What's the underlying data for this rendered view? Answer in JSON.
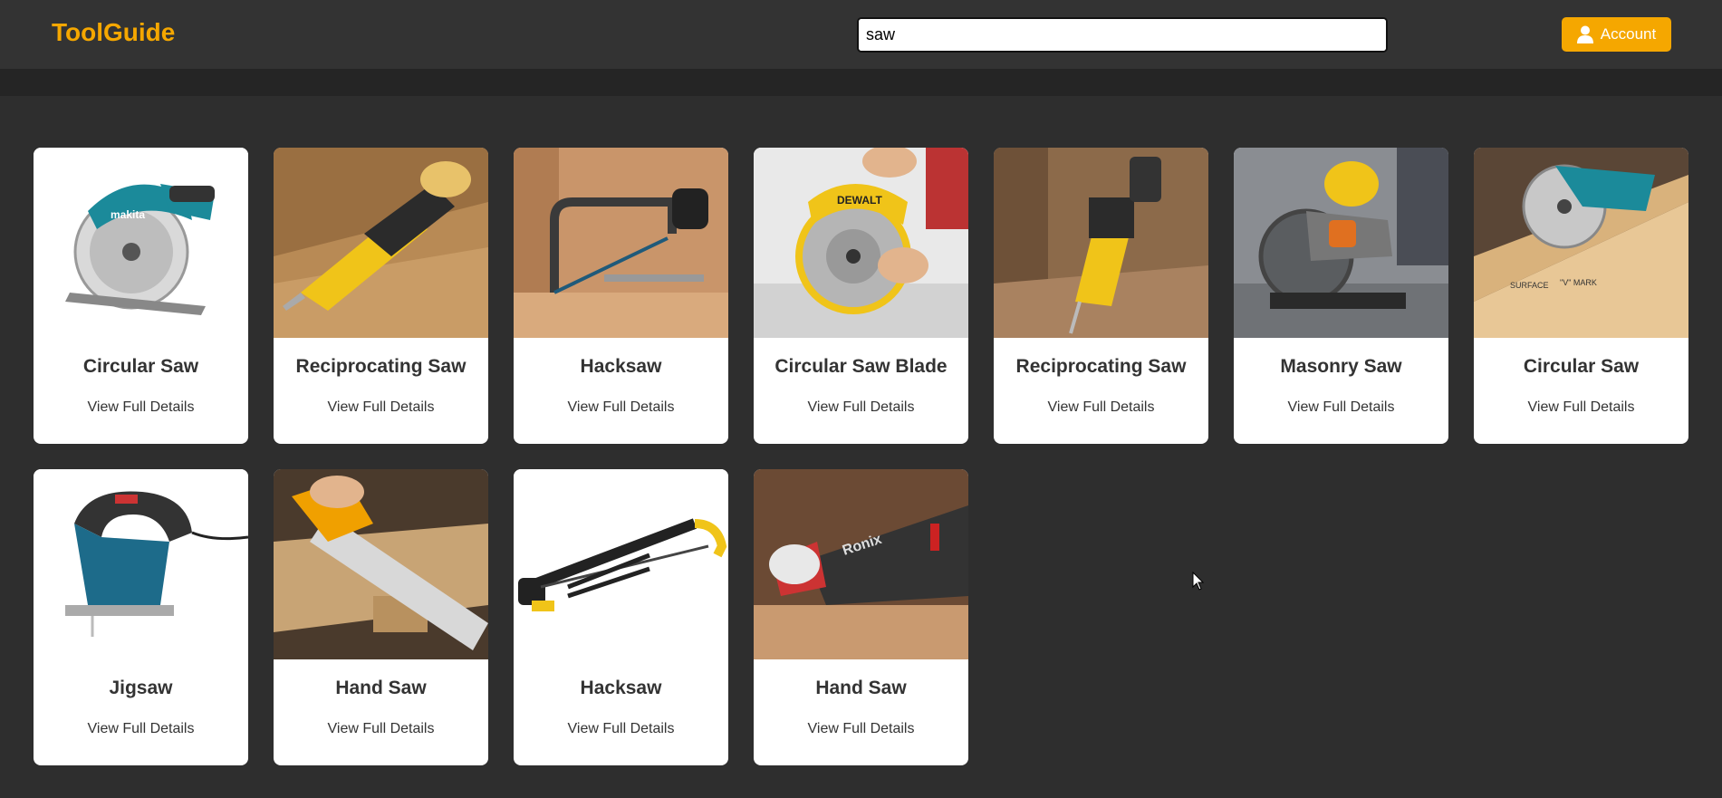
{
  "header": {
    "brand": "ToolGuide",
    "search_value": "saw",
    "account_label": "Account"
  },
  "colors": {
    "brand": "#f5a700",
    "background": "#2e2e2e",
    "topbar": "#333333"
  },
  "cards": [
    {
      "title": "Circular Saw",
      "link": "View Full Details",
      "icon": "circular-saw-icon"
    },
    {
      "title": "Reciprocating Saw",
      "link": "View Full Details",
      "icon": "reciprocating-saw-icon"
    },
    {
      "title": "Hacksaw",
      "link": "View Full Details",
      "icon": "hacksaw-icon"
    },
    {
      "title": "Circular Saw Blade",
      "link": "View Full Details",
      "icon": "circular-saw-blade-icon"
    },
    {
      "title": "Reciprocating Saw",
      "link": "View Full Details",
      "icon": "reciprocating-saw-icon"
    },
    {
      "title": "Masonry Saw",
      "link": "View Full Details",
      "icon": "masonry-saw-icon"
    },
    {
      "title": "Circular Saw",
      "link": "View Full Details",
      "icon": "circular-saw-icon"
    },
    {
      "title": "Jigsaw",
      "link": "View Full Details",
      "icon": "jigsaw-icon"
    },
    {
      "title": "Hand Saw",
      "link": "View Full Details",
      "icon": "hand-saw-icon"
    },
    {
      "title": "Hacksaw",
      "link": "View Full Details",
      "icon": "hacksaw-icon"
    },
    {
      "title": "Hand Saw",
      "link": "View Full Details",
      "icon": "hand-saw-icon"
    }
  ]
}
